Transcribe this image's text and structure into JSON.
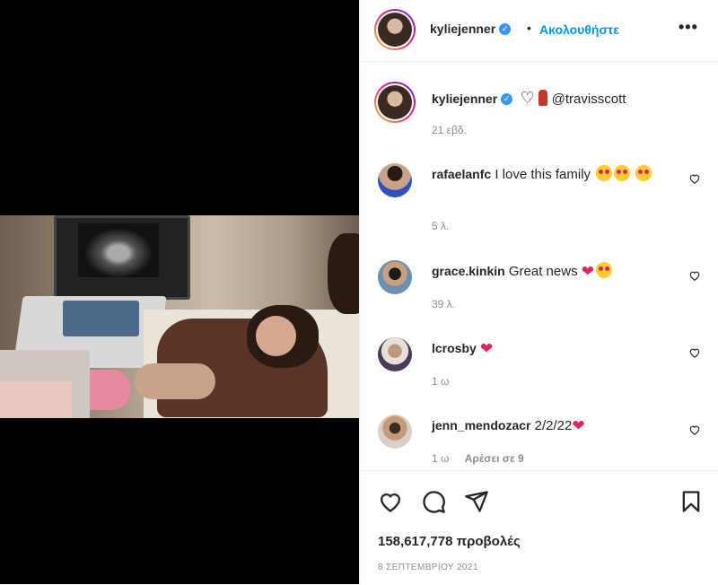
{
  "post": {
    "username": "kyliejenner",
    "verified_mark": "✓",
    "separator": "•",
    "follow_label": "Ακολουθήστε",
    "more_label": "•••",
    "caption_heart": "♡",
    "caption_mention": "@travisscott",
    "caption_time": "21 εβδ."
  },
  "comments": [
    {
      "username": "rafaelanfc",
      "text": "I love this family",
      "time": "5 λ.",
      "likes": ""
    },
    {
      "username": "grace.kinkin",
      "text": "Great news",
      "time": "39 λ.",
      "likes": ""
    },
    {
      "username": "lcrosby",
      "text": "",
      "time": "1 ω",
      "likes": ""
    },
    {
      "username": "jenn_mendozacr",
      "text": "2/2/22",
      "time": "1 ω",
      "likes": "Αρέσει σε 9"
    }
  ],
  "stats": {
    "views": "158,617,778 προβολές",
    "date": "8 ΣΕΠΤΕΜΒΡΙΟΥ 2021"
  },
  "icons": {
    "like": "heart-icon",
    "comment": "comment-bubble-icon",
    "share": "paper-plane-icon",
    "save": "bookmark-icon"
  },
  "colors": {
    "accent": "#0095f6",
    "verified": "#3897f0",
    "heart_red": "#e0245e"
  }
}
